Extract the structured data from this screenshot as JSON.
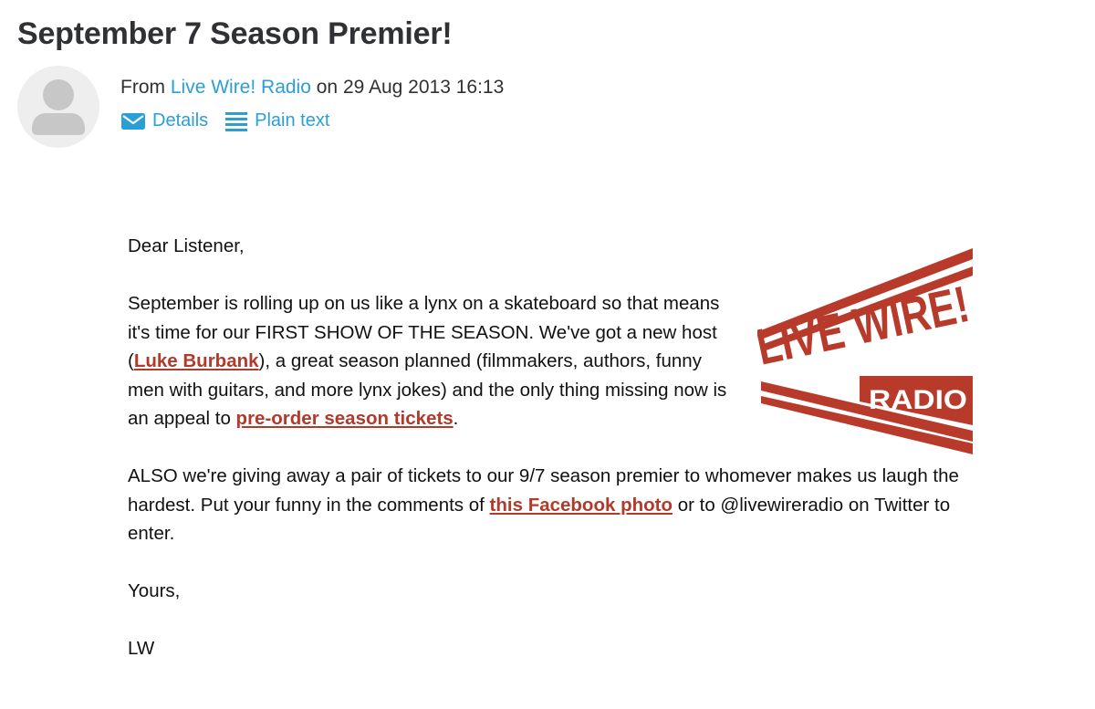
{
  "email": {
    "subject": "September 7 Season Premier!",
    "from_prefix": "From",
    "sender": "Live Wire! Radio",
    "date_text": "on 29 Aug 2013 16:13",
    "actions": {
      "details": "Details",
      "plain_text": "Plain text"
    }
  },
  "body": {
    "greeting": "Dear Listener,",
    "p1": {
      "part1": "September is rolling up on us like a lynx on a skateboard so that means it's time for our FIRST SHOW OF THE SEASON. We've got a new host (",
      "link1": "Luke Burbank",
      "part2": "), a great season planned (filmmakers, authors, funny men with guitars, and more lynx jokes) and the only thing missing now is an appeal to ",
      "link2": "pre-order season tickets",
      "part3": "."
    },
    "p2": {
      "part1": "ALSO we're giving away a pair of tickets to our 9/7 season premier to whomever makes us laugh the hardest. Put your funny in the comments of ",
      "link": "this Facebook photo",
      "part2": " or to @livewireradio on Twitter to enter."
    },
    "closing": "Yours,",
    "signature": "LW"
  },
  "logo": {
    "main_text": "LIVE WIRE!",
    "sub_text": "RADIO",
    "color": "#b83a2a"
  },
  "colors": {
    "link_blue": "#2a9fd6",
    "link_red": "#b23a2a",
    "subject_text": "#2f3135"
  },
  "icons": [
    "user-avatar-icon",
    "envelope-icon",
    "lines-icon"
  ]
}
